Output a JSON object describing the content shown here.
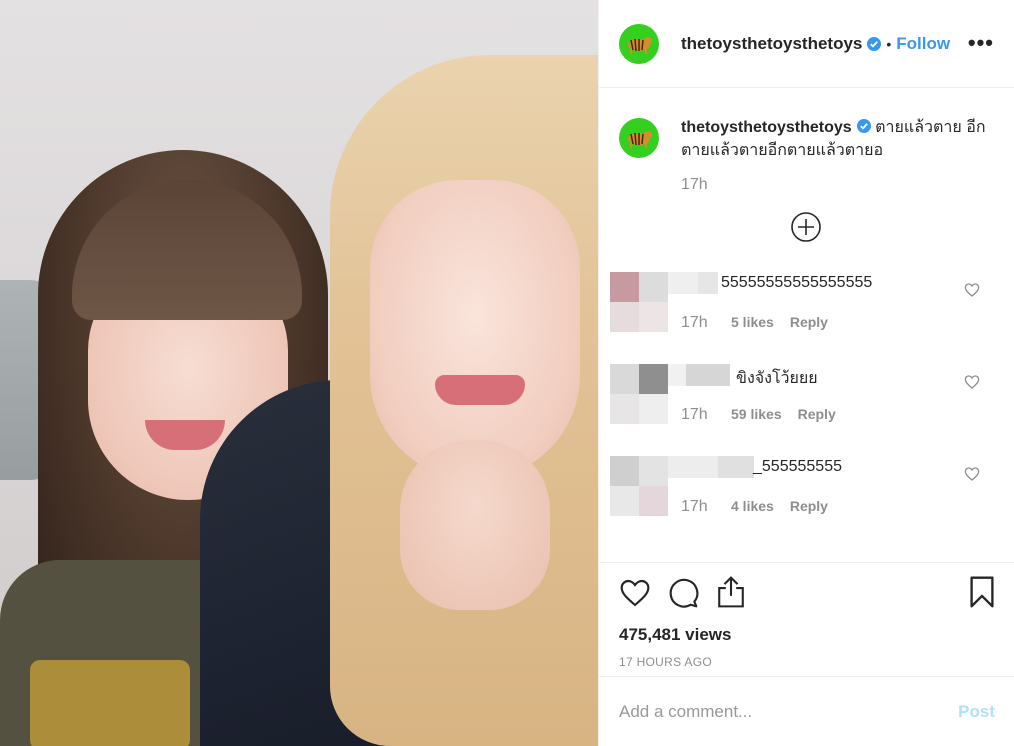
{
  "media": {
    "type": "video"
  },
  "header": {
    "username": "thetoysthetoysthetoys",
    "separator": "•",
    "follow_label": "Follow",
    "more_label": "•••"
  },
  "caption": {
    "username": "thetoysthetoysthetoys",
    "text": "ตายแล้วตาย อีกตายแล้วตายอีกตายแล้วตายอ",
    "time": "17h",
    "load_more_icon": "plus-circle-icon"
  },
  "comments": [
    {
      "text": "55555555555555555",
      "time": "17h",
      "likes": "5 likes",
      "reply": "Reply",
      "avatar_colors": [
        "#c79aa2",
        "#dcdcdc",
        "#e6dcdd",
        "#ece4e5"
      ],
      "name_colors": [
        "#efefef",
        "#e6e6e6"
      ]
    },
    {
      "text": "ขิงจังโว้ยยย",
      "time": "17h",
      "likes": "59 likes",
      "reply": "Reply",
      "avatar_colors": [
        "#d9d9d9",
        "#8f8f8f",
        "#e8e5e6",
        "#eeeeee"
      ],
      "name_colors": [
        "#f1f1f1",
        "#d6d6d6"
      ]
    },
    {
      "text": "_555555555",
      "time": "17h",
      "likes": "4 likes",
      "reply": "Reply",
      "avatar_colors": [
        "#cfcfcf",
        "#e3e3e3",
        "#e8e8e8",
        "#e4d6da"
      ],
      "name_colors": [
        "#ededed",
        "#e0e0e0"
      ]
    }
  ],
  "stats": {
    "views": "475,481 views",
    "age": "17 HOURS AGO"
  },
  "add_comment": {
    "placeholder": "Add a comment...",
    "post_label": "Post"
  },
  "colors": {
    "accent": "#3897f0",
    "avatar_bg": "#35d01f",
    "post_disabled": "#b2dffc",
    "muted": "#8e8e8e"
  }
}
